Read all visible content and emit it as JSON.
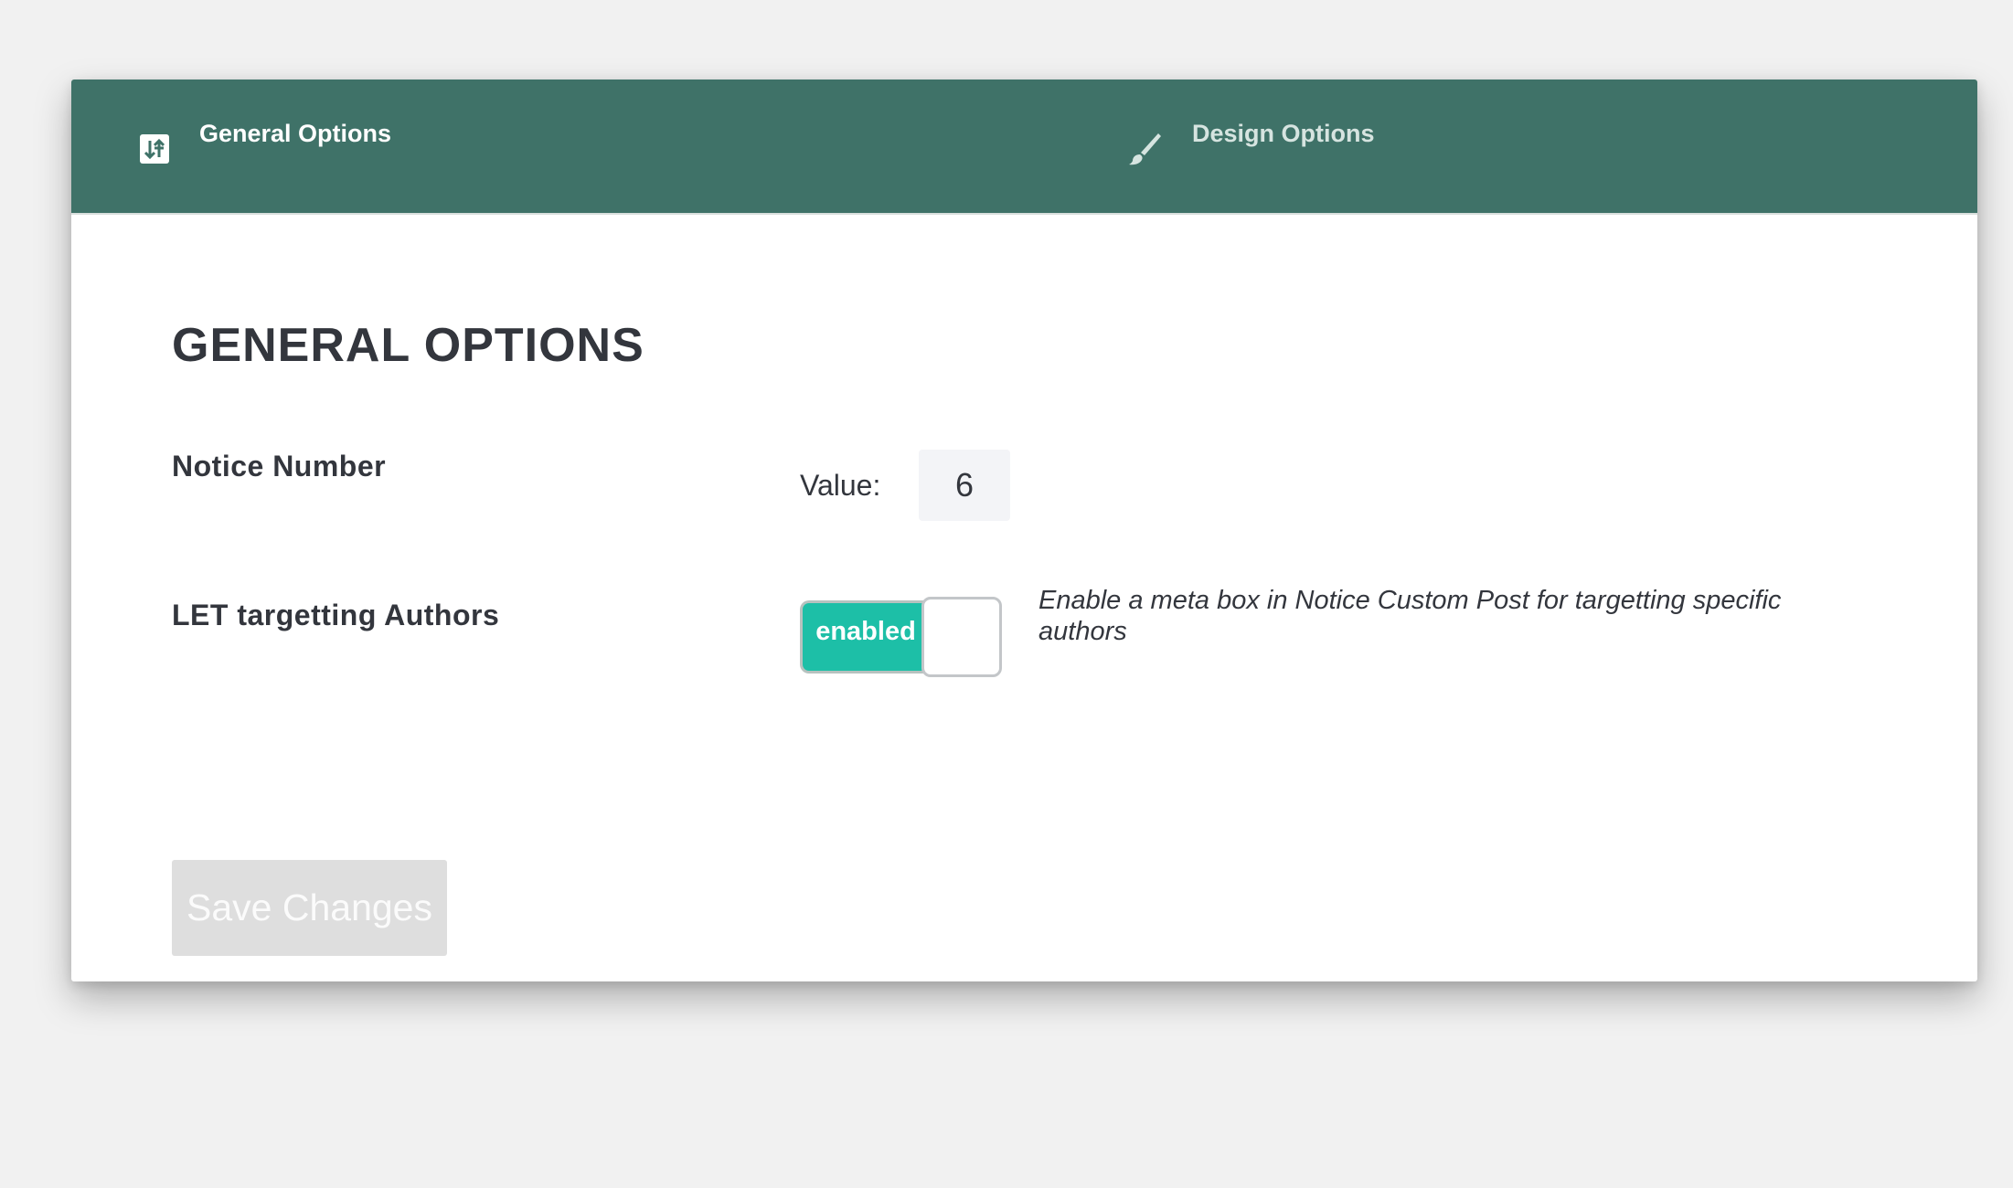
{
  "tabs": {
    "general": {
      "label": "General Options",
      "icon": "sliders-icon",
      "active": true
    },
    "design": {
      "label": "Design Options",
      "icon": "paintbrush-icon",
      "active": false
    }
  },
  "colors": {
    "tabbar_bg": "#3f7268",
    "toggle_on": "#1dbfa7",
    "page_bg": "#f1f1f1",
    "button_disabled": "#dedede"
  },
  "section": {
    "title": "GENERAL OPTIONS"
  },
  "notice_number": {
    "label": "Notice Number",
    "value_label": "Value:",
    "value": "6"
  },
  "targetting_authors": {
    "label": "LET targetting Authors",
    "toggle_text": "enabled",
    "toggle_state": true,
    "help": "Enable a meta box in Notice Custom Post for targetting specific authors"
  },
  "save": {
    "label": "Save Changes"
  }
}
